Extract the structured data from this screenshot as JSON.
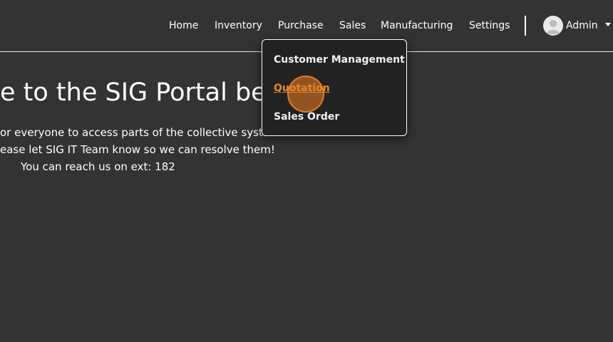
{
  "nav": {
    "items": [
      {
        "label": "Home"
      },
      {
        "label": "Inventory"
      },
      {
        "label": "Purchase"
      },
      {
        "label": "Sales"
      },
      {
        "label": "Manufacturing"
      },
      {
        "label": "Settings"
      }
    ]
  },
  "user": {
    "name": "Admin",
    "avatar_icon": "user-avatar-icon",
    "menu_icon": "caret-down-icon"
  },
  "hero": {
    "title": "e to the SIG Portal bet",
    "lines": [
      "or everyone to access parts of the collective syster",
      "ease let SIG IT Team know so we can resolve them!",
      "You can reach us on ext: 182"
    ]
  },
  "sales_menu": {
    "items": [
      {
        "label": "Customer Management"
      },
      {
        "label": "Quotation"
      },
      {
        "label": "Sales Order"
      }
    ],
    "active_index": 1
  },
  "colors": {
    "background": "#333333",
    "dropdown_background": "#222222",
    "active_link": "#e58a2e",
    "click_marker": "#ec8024"
  }
}
